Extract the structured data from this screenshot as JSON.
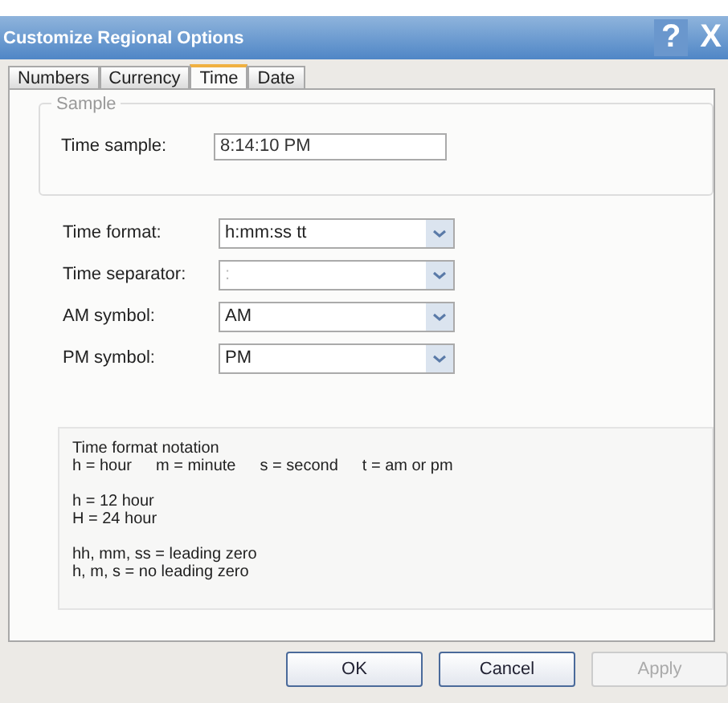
{
  "window": {
    "title": "Customize Regional Options",
    "title_buttons": [
      "?",
      "X"
    ]
  },
  "tabs": [
    {
      "label": "Numbers",
      "selected": false
    },
    {
      "label": "Currency",
      "selected": false
    },
    {
      "label": "Time",
      "selected": true
    },
    {
      "label": "Date",
      "selected": false
    }
  ],
  "sample": {
    "legend": "Sample",
    "label": "Time sample:",
    "value": "8:14:10 PM"
  },
  "settings": [
    {
      "label": "Time format:",
      "value": "h:mm:ss tt",
      "disabled": false
    },
    {
      "label": "Time separator:",
      "value": ":",
      "disabled": true
    },
    {
      "label": "AM symbol:",
      "value": "AM",
      "disabled": false
    },
    {
      "label": "PM symbol:",
      "value": "PM",
      "disabled": false
    }
  ],
  "notation": {
    "title": "Time format notation",
    "legend": [
      "h = hour",
      "m = minute",
      "s = second",
      "t = am or pm"
    ],
    "lines": [
      [
        "h = 12 hour",
        "H = 24 hour"
      ],
      [
        "hh, mm, ss = leading zero",
        "h, m, s = no leading zero"
      ]
    ]
  },
  "buttons": [
    {
      "label": "OK",
      "disabled": false
    },
    {
      "label": "Cancel",
      "disabled": false
    },
    {
      "label": "Apply",
      "disabled": true
    }
  ]
}
